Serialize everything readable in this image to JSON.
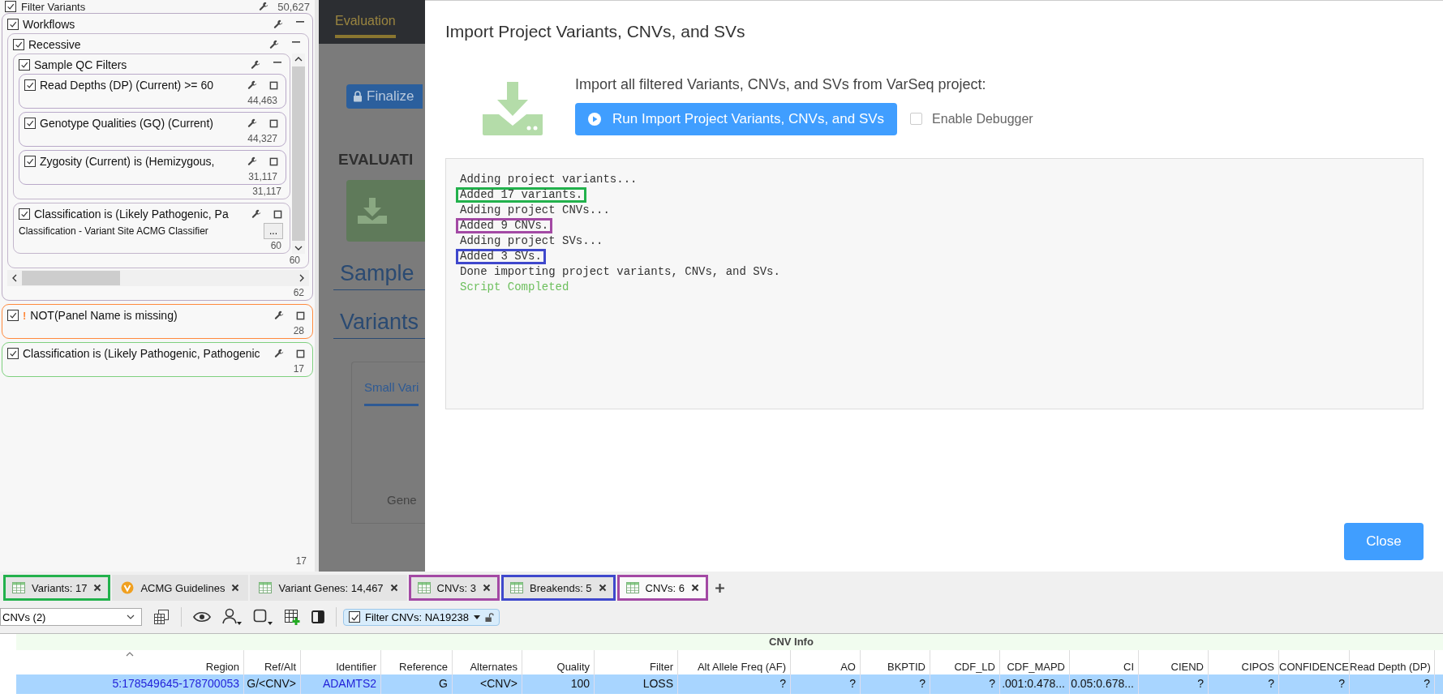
{
  "filter_panel": {
    "title": "Filter Variants",
    "checked": true,
    "count": "50,627",
    "footer_count": "17",
    "filters": [
      {
        "title": "Workflows",
        "checked": true,
        "expanded": true,
        "color": "#b9aac4",
        "count": "62",
        "children": [
          {
            "title": "Recessive",
            "checked": true,
            "expanded": true,
            "color": "#c3b6cc",
            "count": "60",
            "children": [
              {
                "title": "Sample QC Filters",
                "checked": true,
                "expanded": true,
                "color": "#c3b6cc",
                "count": "31,117",
                "children": [
                  {
                    "title": "Read Depths (DP) (Current) >= 60",
                    "checked": true,
                    "color": "#b9a9c9",
                    "count": "44,463"
                  },
                  {
                    "title": "Genotype Qualities (GQ) (Current)",
                    "checked": true,
                    "color": "#b9a9c9",
                    "count": "44,327"
                  },
                  {
                    "title": "Zygosity (Current) is (Hemizygous,",
                    "checked": true,
                    "color": "#b9a9c9",
                    "count": "31,117"
                  }
                ]
              },
              {
                "title": "Classification is (Likely Pathogenic, Pa",
                "checked": true,
                "color": "#c3b6cc",
                "subtitle": "Classification - Variant Site ACMG Classifier",
                "more": "...",
                "count": "60"
              }
            ]
          }
        ]
      },
      {
        "title": "NOT(Panel Name is missing)",
        "checked": true,
        "warning": "!",
        "color": "#ff8a3d",
        "count": "28"
      },
      {
        "title": "Classification is (Likely Pathogenic, Pathogenic",
        "checked": true,
        "color": "#7fd07f",
        "count": "17"
      }
    ]
  },
  "background_page": {
    "tab": "Evaluation",
    "finalize_button": "Finalize",
    "section_heading": "EVALUATI",
    "headings": [
      "Sample",
      "Variants"
    ],
    "card_tab": "Small Vari",
    "card_label": "Gene"
  },
  "dialog": {
    "title": "Import Project Variants, CNVs, and SVs",
    "description": "Import all filtered Variants, CNVs, and SVs from VarSeq project:",
    "run_button": "Run Import Project Variants, CNVs, and SVs",
    "debugger": {
      "label": "Enable Debugger",
      "checked": false
    },
    "console_lines": [
      {
        "text": "Adding project variants...",
        "kind": "log"
      },
      {
        "text": "Added 17 variants.",
        "kind": "log",
        "color": "#22b14c"
      },
      {
        "text": "Adding project CNVs...",
        "kind": "log"
      },
      {
        "text": "Added 9 CNVs.",
        "kind": "log",
        "color": "#a349a4"
      },
      {
        "text": "Adding project SVs...",
        "kind": "log"
      },
      {
        "text": "Added 3 SVs.",
        "kind": "log",
        "color": "#3f48cc"
      },
      {
        "text": "Done importing project variants, CNVs, and SVs.",
        "kind": "log"
      },
      {
        "text": "Script Completed",
        "kind": "success"
      }
    ],
    "close_button": "Close"
  },
  "bottom_tabs": [
    {
      "label": "Variants: 17",
      "kind": "table",
      "selected": false,
      "color": "#22b14c"
    },
    {
      "label": "ACMG Guidelines",
      "kind": "badge",
      "selected": false
    },
    {
      "label": "Variant Genes: 14,467",
      "kind": "table",
      "selected": false
    },
    {
      "label": "CNVs: 3",
      "kind": "table",
      "selected": false,
      "color": "#a349a4"
    },
    {
      "label": "Breakends: 5",
      "kind": "table",
      "selected": false,
      "color": "#3f48cc"
    },
    {
      "label": "CNVs: 6",
      "kind": "table",
      "selected": true,
      "color": "#a349a4"
    }
  ],
  "toolbar": {
    "view_select": "CNVs (2)",
    "filter_chip": {
      "label": "Filter CNVs: NA19238",
      "checked": true
    }
  },
  "table": {
    "group_header": "CNV Info",
    "columns": [
      "Region",
      "Ref/Alt",
      "Identifier",
      "Reference",
      "Alternates",
      "Quality",
      "Filter",
      "Alt Allele Freq (AF)",
      "AO",
      "BKPTID",
      "CDF_LD",
      "CDF_MAPD",
      "CI",
      "CIEND",
      "CIPOS",
      "CONFIDENCE",
      "Read Depth (DP)"
    ],
    "rows": [
      {
        "selected": true,
        "cells": [
          {
            "text": "5:178549645-178700053",
            "kind": "link"
          },
          {
            "text": "G/<CNV>",
            "kind": "text"
          },
          {
            "text": "ADAMTS2",
            "kind": "link"
          },
          {
            "text": "G",
            "kind": "text"
          },
          {
            "text": "<CNV>",
            "kind": "text"
          },
          {
            "text": "100",
            "kind": "text"
          },
          {
            "text": "LOSS",
            "kind": "text"
          },
          {
            "text": "?",
            "kind": "text"
          },
          {
            "text": "?",
            "kind": "text"
          },
          {
            "text": "?",
            "kind": "text"
          },
          {
            "text": "?",
            "kind": "text"
          },
          {
            "text": ".001:0.478...",
            "kind": "text"
          },
          {
            "text": "0.05:0.678...",
            "kind": "text"
          },
          {
            "text": "?",
            "kind": "text"
          },
          {
            "text": "?",
            "kind": "text"
          },
          {
            "text": "?",
            "kind": "text"
          },
          {
            "text": "?",
            "kind": "text"
          }
        ]
      }
    ]
  }
}
